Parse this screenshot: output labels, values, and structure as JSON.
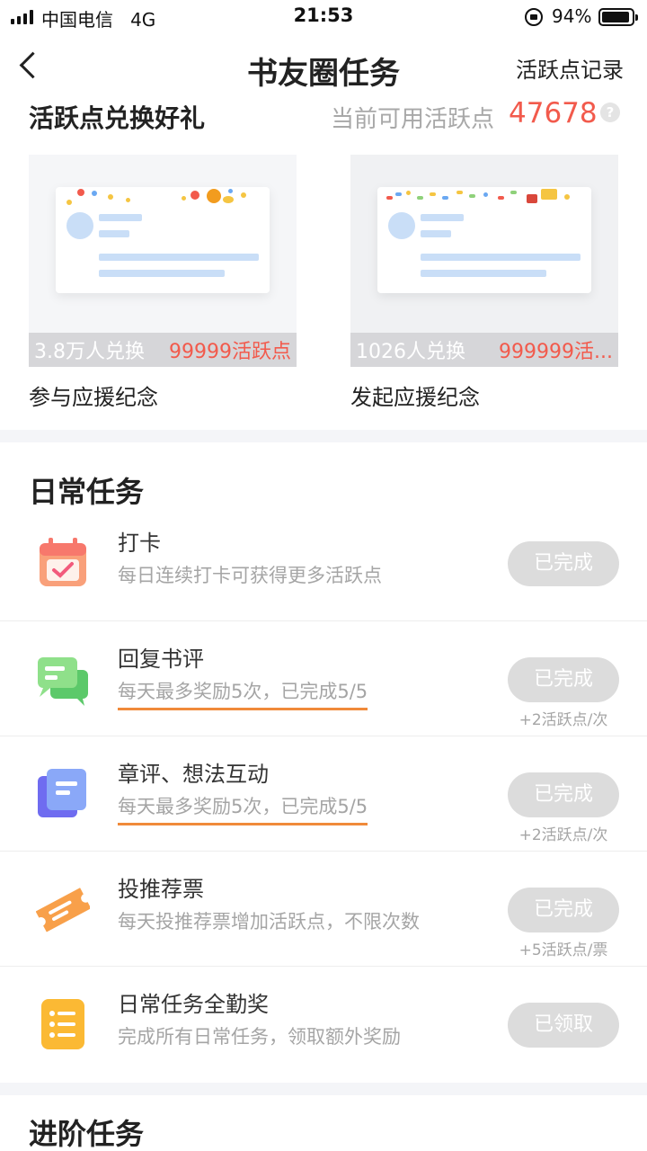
{
  "status_bar": {
    "carrier": "中国电信",
    "network": "4G",
    "time": "21:53",
    "battery": "94%",
    "battery_level": 0.94
  },
  "nav": {
    "title": "书友圈任务",
    "right_link": "活跃点记录"
  },
  "exchange": {
    "title": "活跃点兑换好礼",
    "points_label": "当前可用活跃点",
    "points_value": "47678",
    "help_icon": "?",
    "gifts": [
      {
        "count": "3.8万人兑换",
        "cost": "99999活跃点",
        "name": "参与应援纪念"
      },
      {
        "count": "1026人兑换",
        "cost": "999999活...",
        "name": "发起应援纪念"
      }
    ]
  },
  "daily": {
    "title": "日常任务",
    "tasks": [
      {
        "icon": "calendar-check-icon",
        "name": "打卡",
        "desc": "每日连续打卡可获得更多活跃点",
        "button": "已完成",
        "reward": ""
      },
      {
        "icon": "chat-bubbles-icon",
        "name": "回复书评",
        "desc": "每天最多奖励5次，已完成5/5",
        "button": "已完成",
        "reward": "+2活跃点/次"
      },
      {
        "icon": "document-icon",
        "name": "章评、想法互动",
        "desc": "每天最多奖励5次，已完成5/5",
        "button": "已完成",
        "reward": "+2活跃点/次"
      },
      {
        "icon": "ticket-icon",
        "name": "投推荐票",
        "desc": "每天投推荐票增加活跃点，不限次数",
        "button": "已完成",
        "reward": "+5活跃点/票"
      },
      {
        "icon": "list-icon",
        "name": "日常任务全勤奖",
        "desc": "完成所有日常任务，领取额外奖励",
        "button": "已领取",
        "reward": ""
      }
    ]
  },
  "advanced": {
    "title": "进阶任务"
  },
  "colors": {
    "accent_red": "#f25a4c",
    "underline_orange": "#f08a3a",
    "disabled_button": "#dcdcdc"
  }
}
